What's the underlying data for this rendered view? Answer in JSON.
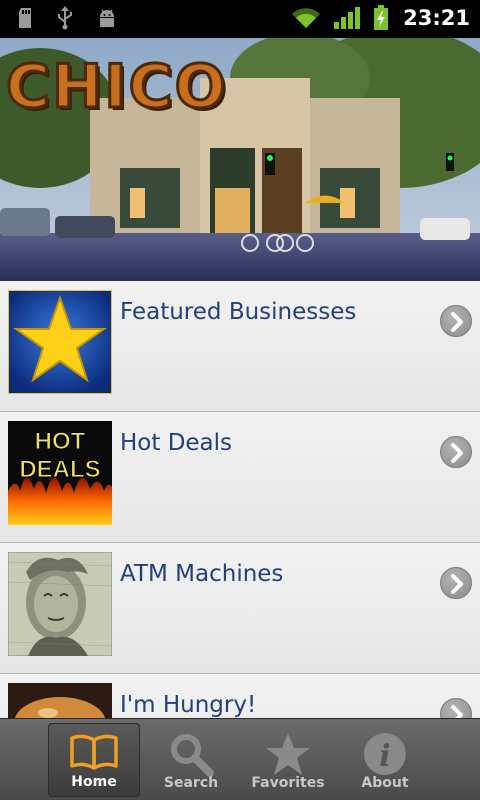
{
  "status_bar": {
    "time": "23:21",
    "icons": [
      "sd-card-icon",
      "usb-icon",
      "android-debug-icon",
      "wifi-icon",
      "signal-icon",
      "battery-charging-icon"
    ]
  },
  "banner": {
    "logo_text": "CHICO"
  },
  "list": {
    "items": [
      {
        "label": "Featured Businesses",
        "icon": "star-icon"
      },
      {
        "label": "Hot Deals",
        "icon": "hot-deals-icon"
      },
      {
        "label": "ATM Machines",
        "icon": "money-icon"
      },
      {
        "label": "I'm Hungry!",
        "icon": "burger-icon"
      }
    ]
  },
  "tabs": [
    {
      "label": "Home",
      "icon": "book-icon",
      "active": true
    },
    {
      "label": "Search",
      "icon": "search-icon",
      "active": false
    },
    {
      "label": "Favorites",
      "icon": "star-icon",
      "active": false
    },
    {
      "label": "About",
      "icon": "info-icon",
      "active": false
    }
  ],
  "colors": {
    "accent_orange": "#f0a020",
    "label_blue": "#23407a",
    "logo_orange": "#c96e1c"
  }
}
